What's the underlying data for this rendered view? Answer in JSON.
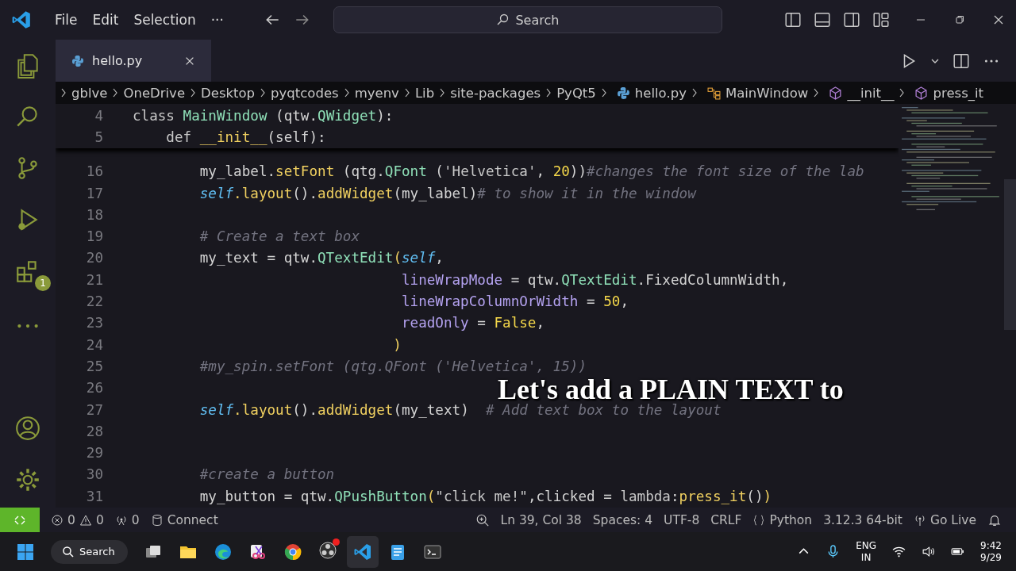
{
  "menu": [
    "File",
    "Edit",
    "Selection",
    "···"
  ],
  "command_center": {
    "label": "Search"
  },
  "tabs": [
    {
      "label": "hello.py",
      "selected": true
    }
  ],
  "breadcrumbs": [
    {
      "label": "gblve",
      "kind": "folder"
    },
    {
      "label": "OneDrive",
      "kind": "folder"
    },
    {
      "label": "Desktop",
      "kind": "folder"
    },
    {
      "label": "pyqtcodes",
      "kind": "folder"
    },
    {
      "label": "myenv",
      "kind": "folder"
    },
    {
      "label": "Lib",
      "kind": "folder"
    },
    {
      "label": "site-packages",
      "kind": "folder"
    },
    {
      "label": "PyQt5",
      "kind": "folder"
    },
    {
      "label": "hello.py",
      "kind": "file"
    },
    {
      "label": "MainWindow",
      "kind": "class"
    },
    {
      "label": "__init__",
      "kind": "method"
    },
    {
      "label": "press_it",
      "kind": "method"
    }
  ],
  "extensions_badge": "1",
  "sticky_lines": [
    {
      "number": "4",
      "kind": "class",
      "tokens": [
        {
          "kind": "keyword",
          "text": "class "
        },
        {
          "kind": "type",
          "text": "MainWindow"
        },
        {
          "kind": "plain",
          "text": " (qtw."
        },
        {
          "kind": "type",
          "text": "QWidget"
        },
        {
          "kind": "plain",
          "text": "):"
        }
      ]
    },
    {
      "number": "5",
      "kind": "method",
      "tokens": [
        {
          "kind": "keyword",
          "text": "def "
        },
        {
          "kind": "function",
          "text": "__init__"
        },
        {
          "kind": "plain",
          "text": "(self):"
        }
      ]
    }
  ],
  "lines": [
    {
      "number": "16",
      "kind": "statement",
      "tokens": [
        {
          "kind": "plain",
          "text": "my_label."
        },
        {
          "kind": "function",
          "text": "setFont"
        },
        {
          "kind": "plain",
          "text": " (qtg."
        },
        {
          "kind": "type",
          "text": "QFont"
        },
        {
          "kind": "plain",
          "text": " ("
        },
        {
          "kind": "string",
          "text": "'Helvetica'"
        },
        {
          "kind": "plain",
          "text": ", "
        },
        {
          "kind": "number",
          "text": "20"
        },
        {
          "kind": "plain",
          "text": "))"
        },
        {
          "kind": "comment",
          "text": "#changes the font size of the lab"
        }
      ]
    },
    {
      "number": "17",
      "kind": "statement",
      "tokens": [
        {
          "kind": "self",
          "text": "self"
        },
        {
          "kind": "function",
          "text": ".layout"
        },
        {
          "kind": "plain",
          "text": "()."
        },
        {
          "kind": "function",
          "text": "addWidget"
        },
        {
          "kind": "plain",
          "text": "(my_label)"
        },
        {
          "kind": "comment",
          "text": "# to show it in the window"
        }
      ]
    },
    {
      "number": "18"
    },
    {
      "number": "19",
      "kind": "statement",
      "tokens": [
        {
          "kind": "comment",
          "text": "# Create a text box"
        }
      ]
    },
    {
      "number": "20",
      "kind": "statement",
      "tokens": [
        {
          "kind": "plain",
          "text": "my_text = qtw."
        },
        {
          "kind": "type",
          "text": "QTextEdit"
        },
        {
          "kind": "bracket",
          "text": "("
        },
        {
          "kind": "self",
          "text": "self"
        },
        {
          "kind": "plain",
          "text": ","
        }
      ]
    },
    {
      "number": "21",
      "kind": "continuation",
      "tokens": [
        {
          "kind": "parameter",
          "text": "lineWrapMode"
        },
        {
          "kind": "plain",
          "text": " = qtw."
        },
        {
          "kind": "type",
          "text": "QTextEdit"
        },
        {
          "kind": "plain",
          "text": ".FixedColumnWidth,"
        }
      ]
    },
    {
      "number": "22",
      "kind": "continuation",
      "tokens": [
        {
          "kind": "parameter",
          "text": "lineWrapColumnOrWidth"
        },
        {
          "kind": "plain",
          "text": " = "
        },
        {
          "kind": "number",
          "text": "50"
        },
        {
          "kind": "plain",
          "text": ","
        }
      ]
    },
    {
      "number": "23",
      "kind": "continuation",
      "tokens": [
        {
          "kind": "parameter",
          "text": "readOnly"
        },
        {
          "kind": "plain",
          "text": " = "
        },
        {
          "kind": "number",
          "text": "False"
        },
        {
          "kind": "plain",
          "text": ","
        }
      ]
    },
    {
      "number": "24",
      "kind": "closer",
      "tokens": [
        {
          "kind": "bracket",
          "text": ")"
        }
      ]
    },
    {
      "number": "25",
      "kind": "statement",
      "tokens": [
        {
          "kind": "comment",
          "text": "#my_spin.setFont (qtg.QFont ('Helvetica', 15))"
        }
      ]
    },
    {
      "number": "26"
    },
    {
      "number": "27",
      "kind": "statement",
      "tokens": [
        {
          "kind": "self",
          "text": "self"
        },
        {
          "kind": "function",
          "text": ".layout"
        },
        {
          "kind": "plain",
          "text": "()."
        },
        {
          "kind": "function",
          "text": "addWidget"
        },
        {
          "kind": "plain",
          "text": "(my_text)  "
        },
        {
          "kind": "comment",
          "text": "# Add text box to the layout"
        }
      ]
    },
    {
      "number": "28"
    },
    {
      "number": "29"
    },
    {
      "number": "30",
      "kind": "statement",
      "tokens": [
        {
          "kind": "comment",
          "text": "#create a button"
        }
      ]
    },
    {
      "number": "31",
      "kind": "statement",
      "tokens": [
        {
          "kind": "plain",
          "text": "my_button = qtw."
        },
        {
          "kind": "type",
          "text": "QPushButton"
        },
        {
          "kind": "bracket",
          "text": "("
        },
        {
          "kind": "string",
          "text": "\"click me!\""
        },
        {
          "kind": "plain",
          "text": ",clicked = "
        },
        {
          "kind": "keyword",
          "text": "lambda"
        },
        {
          "kind": "plain",
          "text": ":"
        },
        {
          "kind": "function",
          "text": "press_it"
        },
        {
          "kind": "plain",
          "text": "()"
        },
        {
          "kind": "bracket",
          "text": ")"
        }
      ]
    }
  ],
  "caption": "Let's add a PLAIN TEXT to",
  "status_bar": {
    "errors": "0",
    "warnings": "0",
    "ports": "0",
    "connect": "Connect",
    "right": [
      {
        "kind": "zoom"
      },
      {
        "kind": "text",
        "text": "Ln 39, Col 38"
      },
      {
        "kind": "text",
        "text": "Spaces: 4"
      },
      {
        "kind": "text",
        "text": "UTF-8"
      },
      {
        "kind": "text",
        "text": "CRLF"
      },
      {
        "kind": "language",
        "text": "Python"
      },
      {
        "kind": "text",
        "text": "3.12.3 64-bit"
      },
      {
        "kind": "live",
        "text": "Go Live"
      },
      {
        "kind": "bell"
      }
    ]
  },
  "taskbar": {
    "search": "Search",
    "language": "ENG",
    "region": "IN",
    "time": "9:42",
    "date": "9/29"
  }
}
